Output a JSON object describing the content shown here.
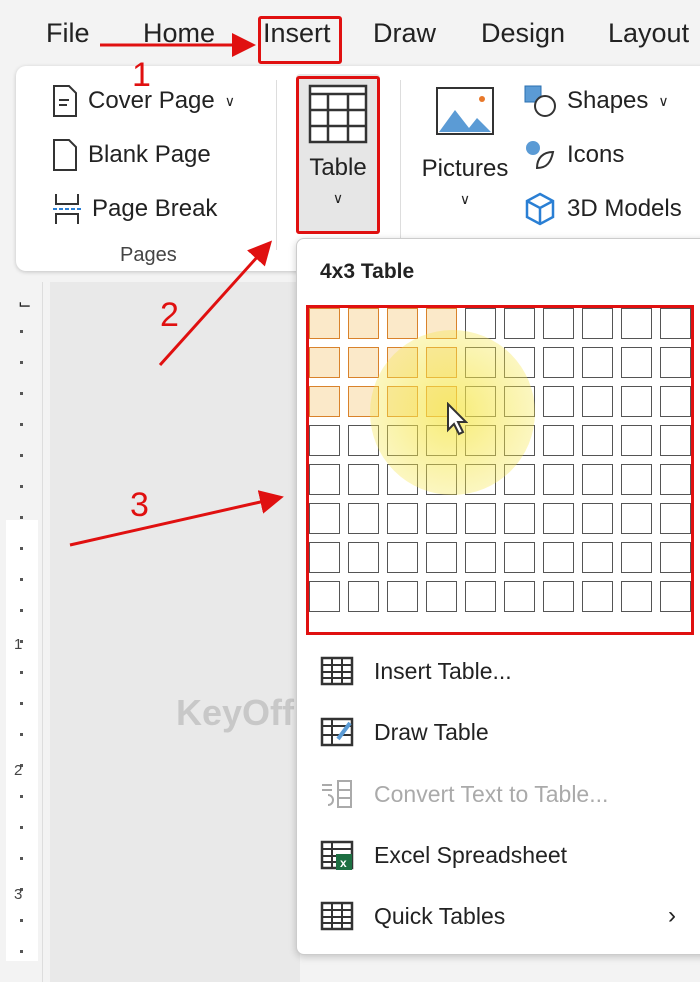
{
  "tabs": [
    {
      "label": "File"
    },
    {
      "label": "Home"
    },
    {
      "label": "Insert"
    },
    {
      "label": "Draw"
    },
    {
      "label": "Design"
    },
    {
      "label": "Layout"
    }
  ],
  "ribbon": {
    "pages": {
      "cover_page": "Cover Page",
      "blank_page": "Blank Page",
      "page_break": "Page Break",
      "group_label": "Pages"
    },
    "table": "Table",
    "pictures": "Pictures",
    "shapes": "Shapes",
    "icons": "Icons",
    "models": "3D Models"
  },
  "dropdown": {
    "header": "4x3 Table",
    "grid": {
      "rows": 8,
      "cols": 10,
      "selected_cols": 4,
      "selected_rows": 3
    },
    "items": [
      {
        "label": "Insert Table...",
        "icon": "table-icon",
        "enabled": true
      },
      {
        "label": "Draw Table",
        "icon": "draw-table-icon",
        "enabled": true
      },
      {
        "label": "Convert Text to Table...",
        "icon": "convert-text-icon",
        "enabled": false
      },
      {
        "label": "Excel Spreadsheet",
        "icon": "excel-icon",
        "enabled": true
      },
      {
        "label": "Quick Tables",
        "icon": "quick-tables-icon",
        "enabled": true,
        "submenu": true
      }
    ]
  },
  "ruler": {
    "labels": [
      "1",
      "2",
      "3"
    ]
  },
  "annotations": [
    "1",
    "2",
    "3"
  ],
  "watermark": "KeyOff",
  "colors": {
    "annotation": "#e01010",
    "highlight": "#f5e64a",
    "excel": "#1d6f42"
  }
}
